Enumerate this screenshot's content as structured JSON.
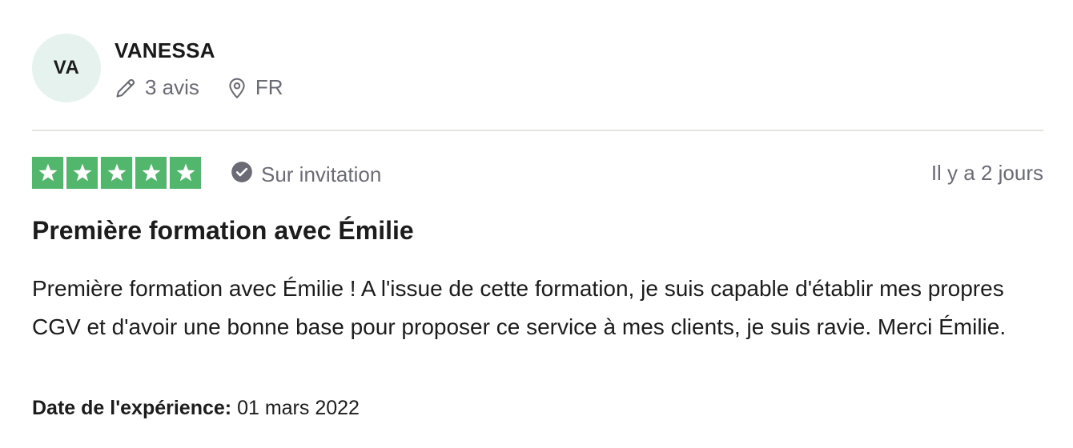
{
  "consumer": {
    "initials": "VA",
    "name": "VANESSA",
    "reviews_count": "3 avis",
    "country": "FR"
  },
  "review": {
    "rating": 5,
    "rating_max": 5,
    "star_color": "#52b76d",
    "verification_label": "Sur invitation",
    "relative_date": "Il y a 2 jours",
    "title": "Première formation avec Émilie",
    "body": "Première formation avec Émilie ! A l'issue de cette formation, je suis capable d'établir mes propres CGV et d'avoir une bonne base pour proposer ce service à mes clients, je suis ravie. Merci Émilie.",
    "experience_label": "Date de l'expérience:",
    "experience_date": "01 mars 2022"
  },
  "icons": {
    "reviews": "pencil-icon",
    "country": "location-pin-icon",
    "verification": "checkmark-circle-icon",
    "rating": "star-icon"
  },
  "colors": {
    "avatar_bg": "#e5f2ee",
    "muted_text": "#6b6b75",
    "divider": "#e5e5dd"
  }
}
